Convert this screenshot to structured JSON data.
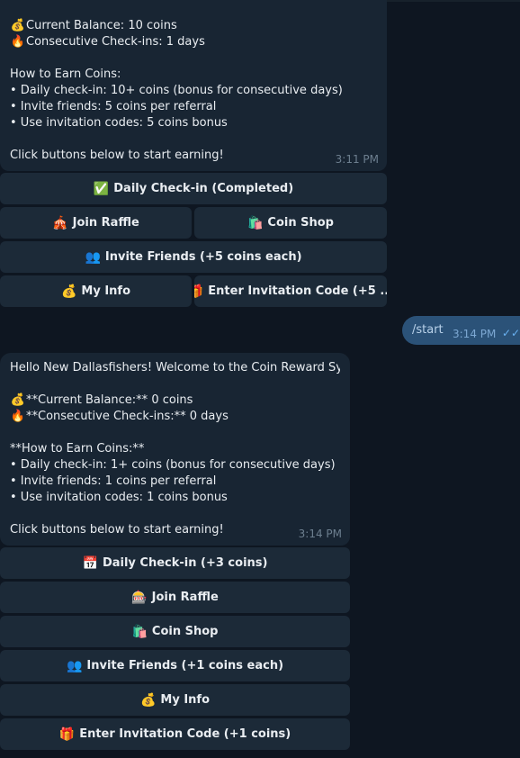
{
  "msg1": {
    "lines": [
      {
        "icon": "💰",
        "text": "Current Balance: 10 coins"
      },
      {
        "icon": "🔥",
        "text": "Consecutive Check-ins: 1 days"
      },
      {
        "text": ""
      },
      {
        "text": "How to Earn Coins:"
      },
      {
        "text": "• Daily check-in: 10+ coins (bonus for consecutive days)"
      },
      {
        "text": "• Invite friends: 5 coins per referral"
      },
      {
        "text": "• Use invitation codes: 5 coins bonus"
      },
      {
        "text": ""
      },
      {
        "text": "Click buttons below to start earning!"
      }
    ],
    "time": "3:11 PM",
    "buttons": [
      {
        "icon": "✅",
        "label": "Daily Check-in (Completed)"
      },
      {
        "icon": "🎪",
        "label": "Join Raffle"
      },
      {
        "icon": "🛍️",
        "label": "Coin Shop"
      },
      {
        "icon": "👥",
        "label": "Invite Friends (+5 coins each)"
      },
      {
        "icon": "💰",
        "label": "My Info"
      },
      {
        "icon": "🎁",
        "label": "Enter Invitation Code (+5 ..."
      }
    ]
  },
  "outgoing": {
    "text": "/start",
    "time": "3:14 PM",
    "status": "✓✓"
  },
  "msg2": {
    "lines": [
      {
        "text": "Hello New Dallasfishers! Welcome to the Coin Reward System!"
      },
      {
        "text": ""
      },
      {
        "icon": "💰",
        "text": "**Current Balance:** 0 coins"
      },
      {
        "icon": "🔥",
        "text": "**Consecutive Check-ins:** 0 days"
      },
      {
        "text": ""
      },
      {
        "text": "**How to Earn Coins:**"
      },
      {
        "text": "• Daily check-in: 1+ coins (bonus for consecutive days)"
      },
      {
        "text": "• Invite friends: 1 coins per referral"
      },
      {
        "text": "• Use invitation codes: 1 coins bonus"
      },
      {
        "text": ""
      },
      {
        "text": "Click buttons below to start earning!"
      }
    ],
    "time": "3:14 PM",
    "buttons": [
      {
        "icon": "📅",
        "label": "Daily Check-in (+3 coins)"
      },
      {
        "icon": "🎰",
        "label": "Join Raffle"
      },
      {
        "icon": "🛍️",
        "label": "Coin Shop"
      },
      {
        "icon": "👥",
        "label": "Invite Friends (+1 coins each)"
      },
      {
        "icon": "💰",
        "label": "My Info"
      },
      {
        "icon": "🎁",
        "label": "Enter Invitation Code (+1 coins)"
      }
    ]
  }
}
